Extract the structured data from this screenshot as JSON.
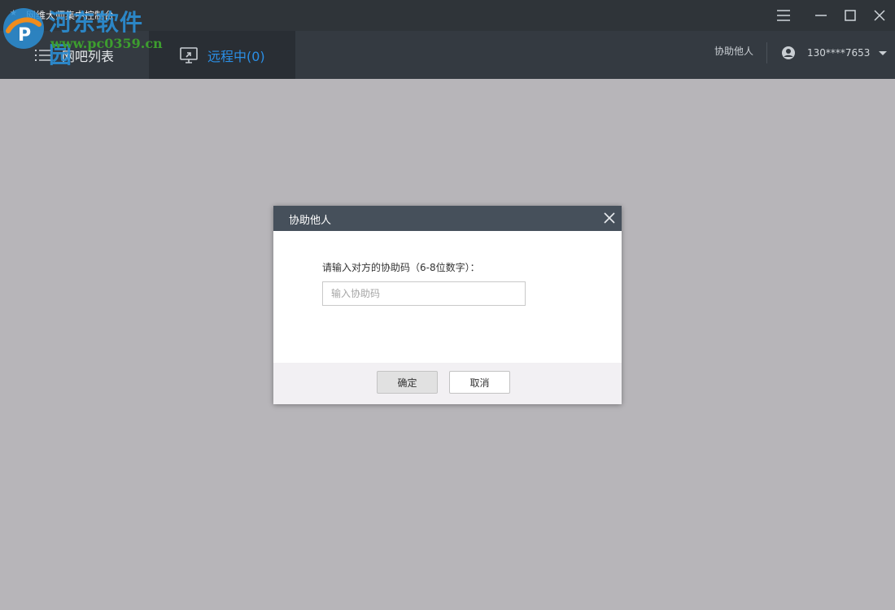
{
  "window": {
    "title": "网维大师集中控制台",
    "controls": [
      "menu-icon",
      "minimize-icon",
      "maximize-icon",
      "close-icon"
    ]
  },
  "watermark": {
    "site_name": "河东软件园",
    "url": "www.pc0359.cn"
  },
  "nav": {
    "tabs": [
      {
        "label": "网吧列表",
        "icon": "list-icon",
        "active": false
      },
      {
        "label": "远程中(0)",
        "icon": "remote-desktop-icon",
        "active": true
      }
    ],
    "help_link": "协助他人",
    "user": {
      "phone": "130****7653",
      "icon": "user-icon"
    }
  },
  "dialog": {
    "title": "协助他人",
    "prompt": "请输入对方的协助码（6-8位数字）：",
    "input": {
      "placeholder": "输入协助码",
      "value": ""
    },
    "ok_label": "确定",
    "cancel_label": "取消"
  },
  "colors": {
    "titlebar": "#2f3439",
    "navbar": "#343a41",
    "active_tab_bg": "#292e34",
    "accent": "#2a8fe6",
    "dialog_header": "#46505b",
    "backdrop": "#b7b5b9"
  }
}
